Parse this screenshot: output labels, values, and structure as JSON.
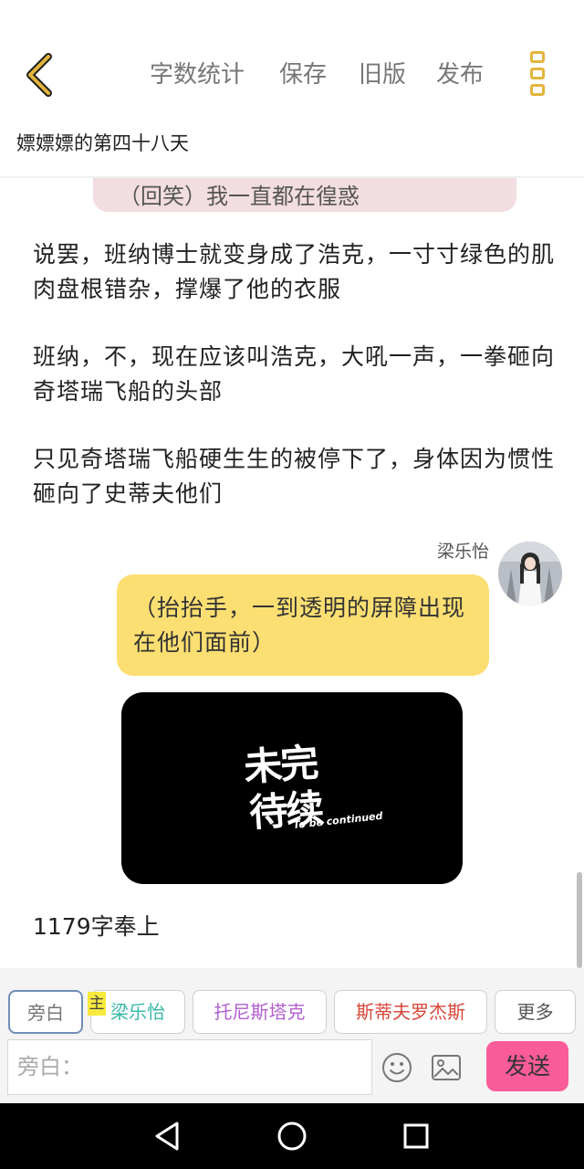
{
  "header": {
    "back_icon": "chevron-left-icon",
    "actions": [
      "字数统计",
      "保存",
      "旧版",
      "发布"
    ],
    "more_icon": "more-vertical-icon",
    "accent_color": "#e2b53c"
  },
  "story": {
    "title": "嫖嫖嫖的第四十八天"
  },
  "content": {
    "partial_bubble_text": "（回笑）我一直都在徨惑",
    "paragraphs": [
      "说罢，班纳博士就变身成了浩克，一寸寸绿色的肌肉盘根错杂，撑爆了他的衣服",
      "班纳，不，现在应该叫浩克，大吼一声，一拳砸向奇塔瑞飞船的头部",
      "只见奇塔瑞飞船硬生生的被停下了，身体因为惯性砸向了史蒂夫他们"
    ],
    "message": {
      "speaker": "梁乐怡",
      "text": "（抬抬手，一到透明的屏障出现在他们面前）",
      "bubble_color": "#fcdf72"
    },
    "image": {
      "line1": "未完",
      "line2": "待续",
      "caption": "To be continued"
    },
    "word_count": "1179字奉上"
  },
  "composer": {
    "roles": [
      {
        "label": "旁白",
        "color": "#777777"
      },
      {
        "label": "梁乐怡",
        "color": "#3ab8a8"
      },
      {
        "label": "托尼斯塔克",
        "color": "#b15fcf"
      },
      {
        "label": "斯蒂夫罗杰斯",
        "color": "#d8483b"
      },
      {
        "label": "更多",
        "color": "#555555"
      }
    ],
    "host_badge": "主",
    "input_placeholder": "旁白：",
    "emoji_icon": "smiley-icon",
    "image_icon": "image-icon",
    "send_label": "发送",
    "send_color": "#f95c98"
  },
  "system_nav": {
    "icons": [
      "back-triangle-icon",
      "home-circle-icon",
      "recents-square-icon"
    ]
  }
}
